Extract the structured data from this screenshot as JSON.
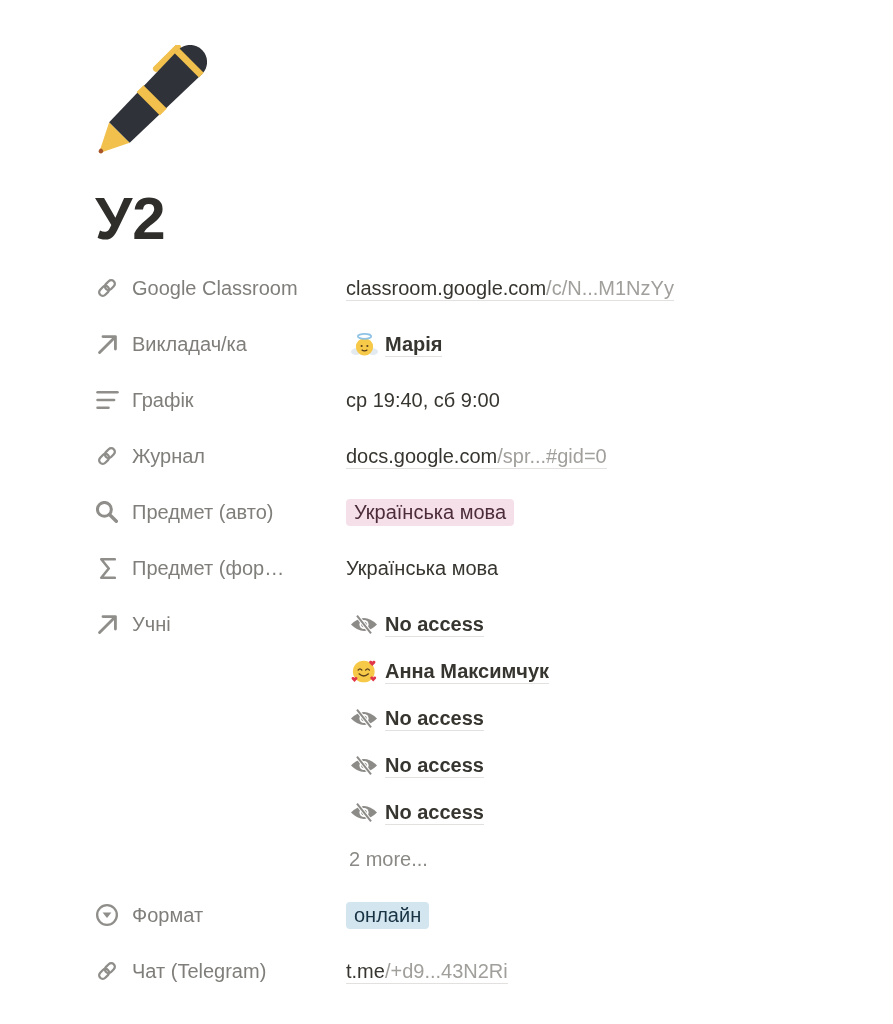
{
  "page": {
    "title": "У2"
  },
  "properties": [
    {
      "kind": "url",
      "label": "Google Classroom",
      "link_host": "classroom.google.com",
      "link_path": "/c/N...M1NzYy"
    },
    {
      "kind": "relation",
      "label": "Викладач/ка",
      "items": [
        {
          "kind": "page",
          "name": "Марія"
        }
      ]
    },
    {
      "kind": "text",
      "label": "Графік",
      "value": "ср 19:40, сб 9:00"
    },
    {
      "kind": "url",
      "label": "Журнал",
      "link_host": "docs.google.com",
      "link_path": "/spr...#gid=0"
    },
    {
      "kind": "rollup",
      "label": "Предмет (авто)",
      "tag": {
        "text": "Українська мова",
        "color": "#f5e0e9"
      }
    },
    {
      "kind": "formula",
      "label": "Предмет (фор…",
      "value": "Українська мова"
    },
    {
      "kind": "relation",
      "label": "Учні",
      "items": [
        {
          "kind": "restricted",
          "name": "No access"
        },
        {
          "kind": "page",
          "name": "Анна Максимчук"
        },
        {
          "kind": "restricted",
          "name": "No access"
        },
        {
          "kind": "restricted",
          "name": "No access"
        },
        {
          "kind": "restricted",
          "name": "No access"
        }
      ],
      "more": "2 more..."
    },
    {
      "kind": "select",
      "label": "Формат",
      "tag": {
        "text": "онлайн",
        "color": "#d3e5ef"
      }
    },
    {
      "kind": "url",
      "label": "Чат (Telegram)",
      "link_host": "t.me",
      "link_path": "/+d9...43N2Ri"
    }
  ]
}
